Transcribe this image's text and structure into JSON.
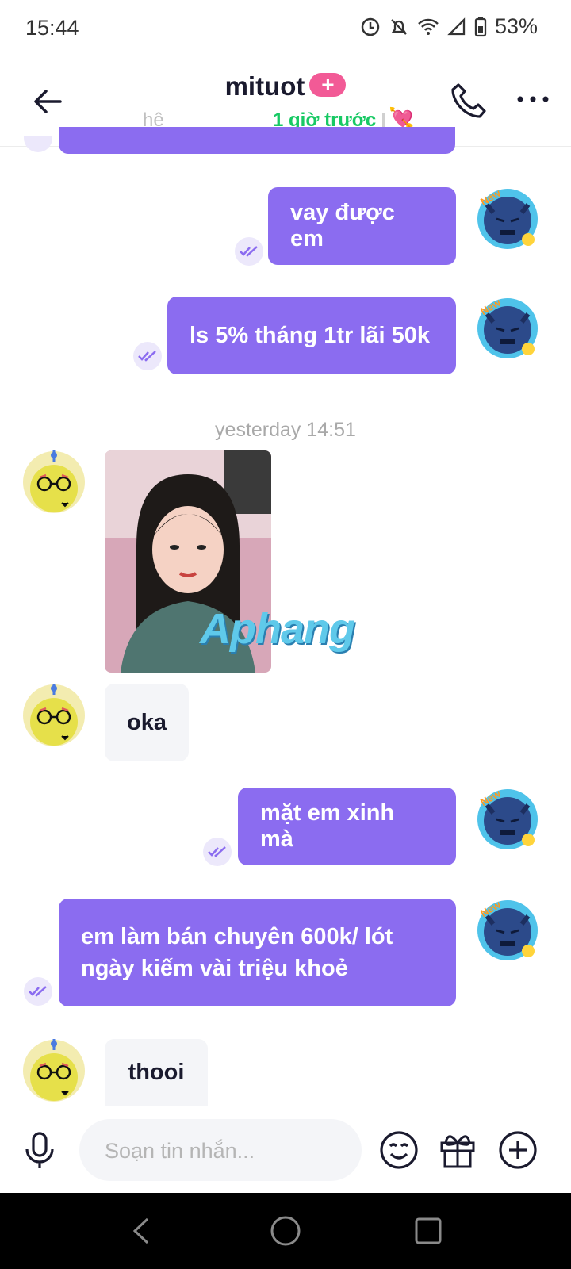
{
  "status": {
    "time": "15:44",
    "battery": "53%"
  },
  "header": {
    "title": "mituot",
    "badge": "+",
    "subtitle_fragment": "hệ",
    "online_status": "1 giờ trước",
    "heart_emoji": "💘"
  },
  "messages": [
    {
      "from": "me",
      "text": "vay được em"
    },
    {
      "from": "me",
      "text": "ls 5% tháng 1tr lãi 50k"
    },
    {
      "type": "timestamp",
      "text": "yesterday 14:51"
    },
    {
      "from": "other",
      "type": "photo",
      "watermark": "Aphang"
    },
    {
      "from": "other",
      "text": "oka"
    },
    {
      "from": "me",
      "text": "mặt em xinh mà"
    },
    {
      "from": "me",
      "text_lines": [
        "em làm bán chuyên 600k/ lót",
        "ngày kiếm vài triệu khoẻ"
      ]
    },
    {
      "from": "other",
      "text": "thooi"
    }
  ],
  "avatar_badge": "New",
  "input": {
    "placeholder": "Soạn tin nhắn..."
  },
  "icons": [
    "back-arrow-icon",
    "phone-icon",
    "more-icon",
    "read-check-icon",
    "mic-icon",
    "emoji-icon",
    "gift-icon",
    "add-icon"
  ],
  "colors": {
    "accent": "#8b6cf0",
    "online": "#18c964",
    "badge": "#f25a96"
  }
}
